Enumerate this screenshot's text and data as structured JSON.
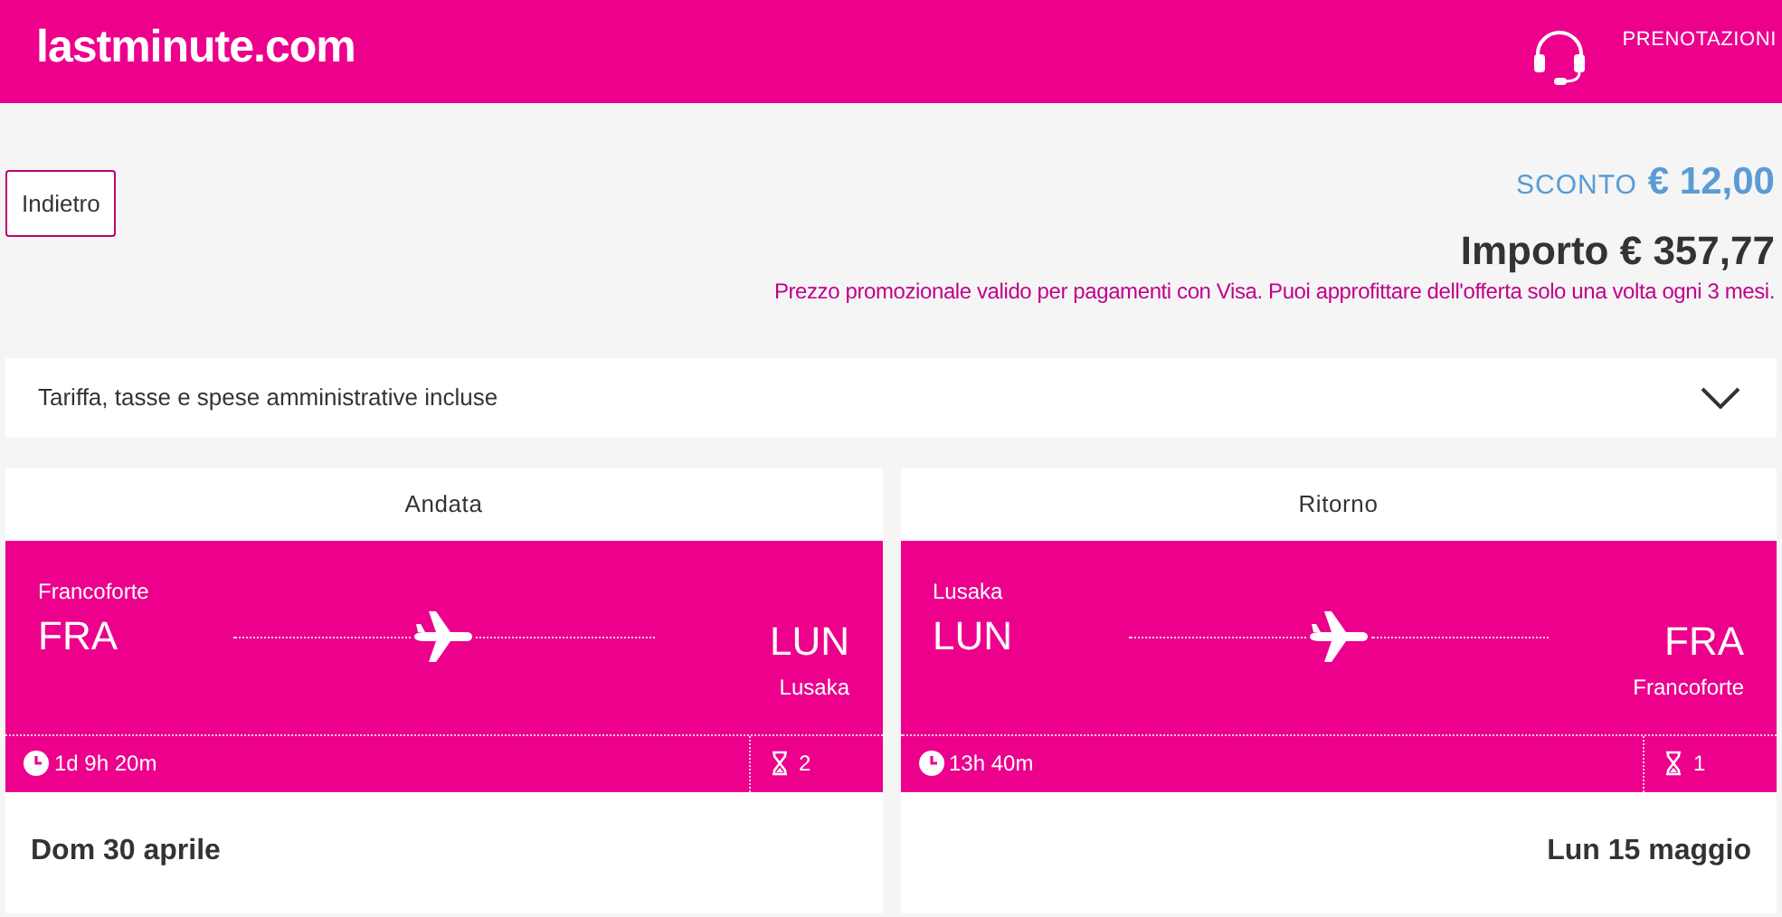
{
  "header": {
    "logo": "lastminute.com",
    "bookings_label": "PRENOTAZIONI"
  },
  "summary": {
    "back_button": "Indietro",
    "discount_label": "SCONTO",
    "discount_amount": "€ 12,00",
    "total": "Importo € 357,77",
    "promo_note": "Prezzo promozionale valido per pagamenti con Visa. Puoi approfittare dell'offerta solo una volta ogni 3 mesi."
  },
  "fare_details": {
    "label": "Tariffa, tasse e spese amministrative incluse",
    "expanded": false
  },
  "flights": [
    {
      "title": "Andata",
      "origin_city": "Francoforte",
      "origin_code": "FRA",
      "destination_code": "LUN",
      "destination_city": "Lusaka",
      "duration": "1d 9h 20m",
      "stops": "2",
      "date": "Dom 30 aprile",
      "kind": "outbound"
    },
    {
      "title": "Ritorno",
      "origin_city": "Lusaka",
      "origin_code": "LUN",
      "destination_code": "FRA",
      "destination_city": "Francoforte",
      "duration": "13h 40m",
      "stops": "1",
      "date": "Lun 15 maggio",
      "kind": "return"
    }
  ]
}
